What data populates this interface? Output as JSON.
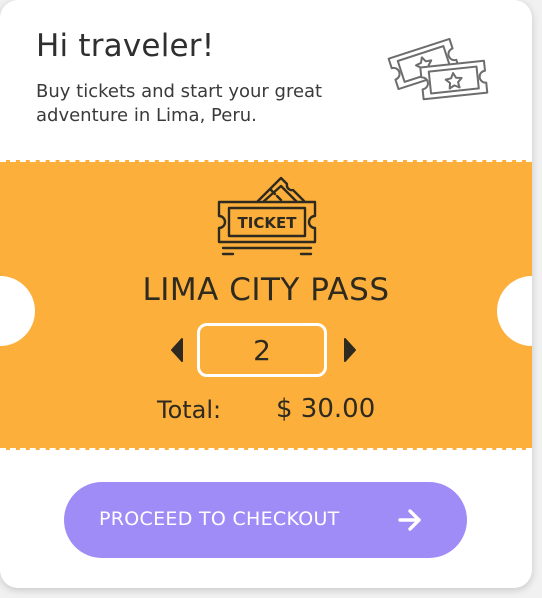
{
  "header": {
    "greeting": "Hi traveler!",
    "subtitle": "Buy tickets and start your great adventure in Lima, Peru.",
    "icon": "tickets-icon"
  },
  "ticket": {
    "icon": "ticket-icon",
    "icon_label": "TICKET",
    "name": "LIMA CITY PASS",
    "quantity": "2",
    "total_label": "Total:",
    "total_value": "$ 30.00",
    "decrement_icon": "caret-left-icon",
    "increment_icon": "caret-right-icon"
  },
  "checkout": {
    "label": "PROCEED TO CHECKOUT",
    "icon": "arrow-right-icon"
  },
  "colors": {
    "accent": "#fcb03b",
    "button": "#a08cf7",
    "text": "#2e2a20"
  }
}
